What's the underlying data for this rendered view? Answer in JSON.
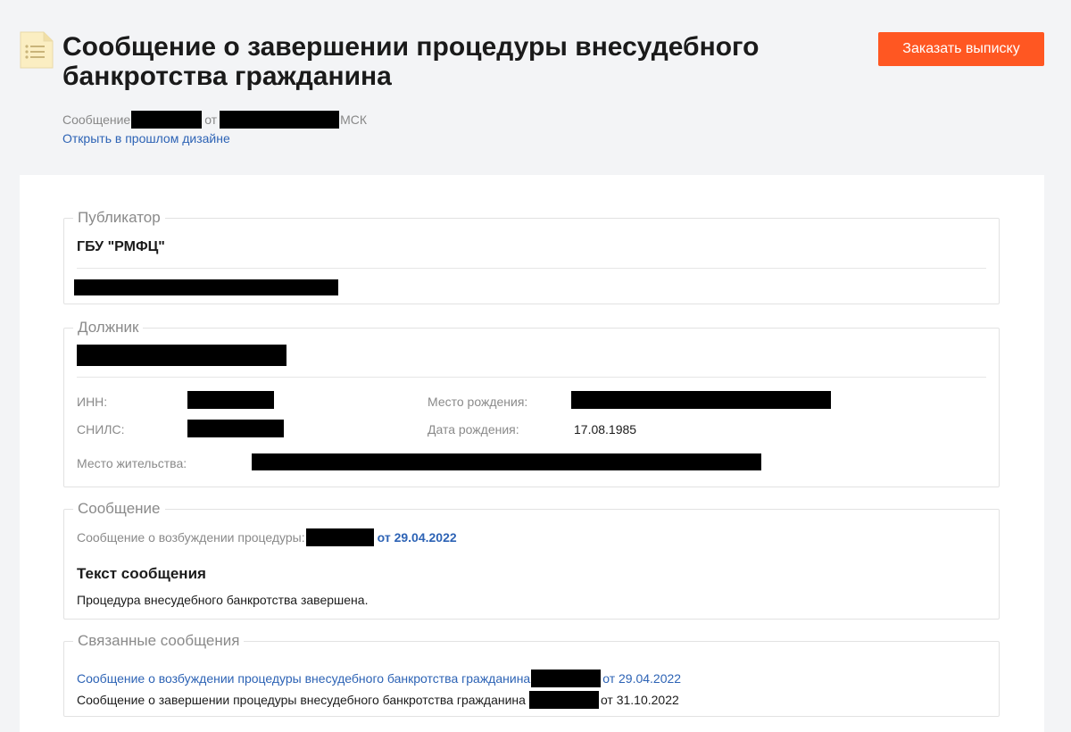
{
  "header": {
    "title": "Сообщение о завершении процедуры внесудебного банкротства гражданина",
    "order_button": "Заказать выписку",
    "meta_prefix": "Сообщение",
    "meta_from": "от",
    "meta_tz": "МСК",
    "old_design_link": "Открыть в прошлом дизайне"
  },
  "publisher": {
    "legend": "Публикатор",
    "name": "ГБУ \"РМФЦ\""
  },
  "debtor": {
    "legend": "Должник",
    "inn_label": "ИНН:",
    "snils_label": "СНИЛС:",
    "birthplace_label": "Место рождения:",
    "birthdate_label": "Дата рождения:",
    "birthdate_value": "17.08.1985",
    "residence_label": "Место жительства:"
  },
  "message": {
    "legend": "Сообщение",
    "initiation_label": "Сообщение о возбуждении процедуры:",
    "initiation_date": "от 29.04.2022",
    "text_heading": "Текст сообщения",
    "text_body": "Процедура внесудебного банкротства завершена."
  },
  "related": {
    "legend": "Связанные сообщения",
    "items": [
      {
        "title": "Сообщение о возбуждении процедуры внесудебного банкротства гражданина",
        "date": "от 29.04.2022"
      },
      {
        "title": "Сообщение о завершении процедуры внесудебного банкротства гражданина",
        "date": "от 31.10.2022"
      }
    ]
  },
  "colors": {
    "accent": "#ff5722",
    "link": "#2d63b5",
    "background": "#f3f4f6"
  },
  "icons": {
    "document": "document-list-icon"
  }
}
